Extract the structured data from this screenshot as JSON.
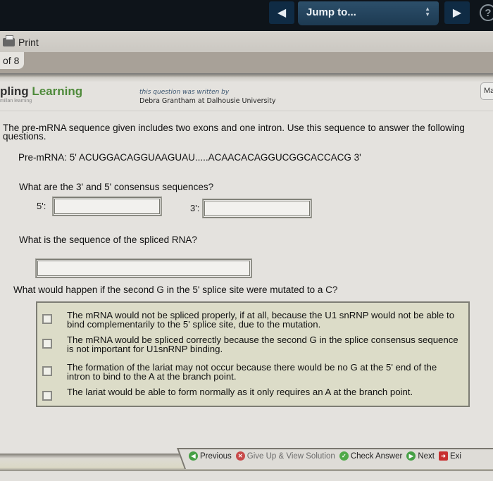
{
  "topbar": {
    "prev_icon": "◀",
    "jump_label": "Jump to...",
    "jump_arrows_up": "▲",
    "jump_arrows_down": "▼",
    "next_icon": "▶",
    "help_icon": "?"
  },
  "printbar": {
    "print_label": "Print"
  },
  "tabs": {
    "page_label": "of 8"
  },
  "header": {
    "brand_part1": "pling ",
    "brand_part2": "Learning",
    "brand_sub": "millan learning",
    "author_label": "this question was written by",
    "author_name": "Debra Grantham at Dalhousie University",
    "mode_tab": "Ma"
  },
  "question": {
    "intro": "The pre-mRNA sequence given includes two exons and one intron. Use this sequence to answer the following questions.",
    "sequence": "Pre-mRNA: 5' ACUGGACAGGUAAGUAU.....ACAACACAGGUCGGCACCACG 3'",
    "q1": "What are the 3' and 5' consensus sequences?",
    "label_5": "5':",
    "label_3": "3':",
    "input_5_value": "",
    "input_3_value": "",
    "q2": "What is the sequence of the spliced RNA?",
    "spliced_value": "",
    "q3": "What would happen if the second G in the 5' splice site were mutated to a C?",
    "options": [
      {
        "text": "The mRNA would not be spliced properly, if at all, because the U1 snRNP would not be able to bind complementarily to the 5' splice site, due to the mutation.",
        "checked": false
      },
      {
        "text": "The mRNA would be spliced correctly because the second G in the splice consensus sequence is not important for U1snRNP binding.",
        "checked": false
      },
      {
        "text": "The formation of the lariat may not occur because there would be no G at the 5' end of the intron to bind to the A at the branch point.",
        "checked": false
      },
      {
        "text": "The lariat would be able to form normally as it only requires an A at the branch point.",
        "checked": false
      }
    ]
  },
  "actions": {
    "previous": "Previous",
    "give_up": "Give Up & View Solution",
    "check": "Check Answer",
    "next": "Next",
    "exit": "Exi"
  },
  "colors": {
    "brand_green": "#4e8a3a",
    "topbar_bg": "#0e141a",
    "nav_blue": "#1d3a52",
    "options_bg": "#dcdcc8"
  }
}
